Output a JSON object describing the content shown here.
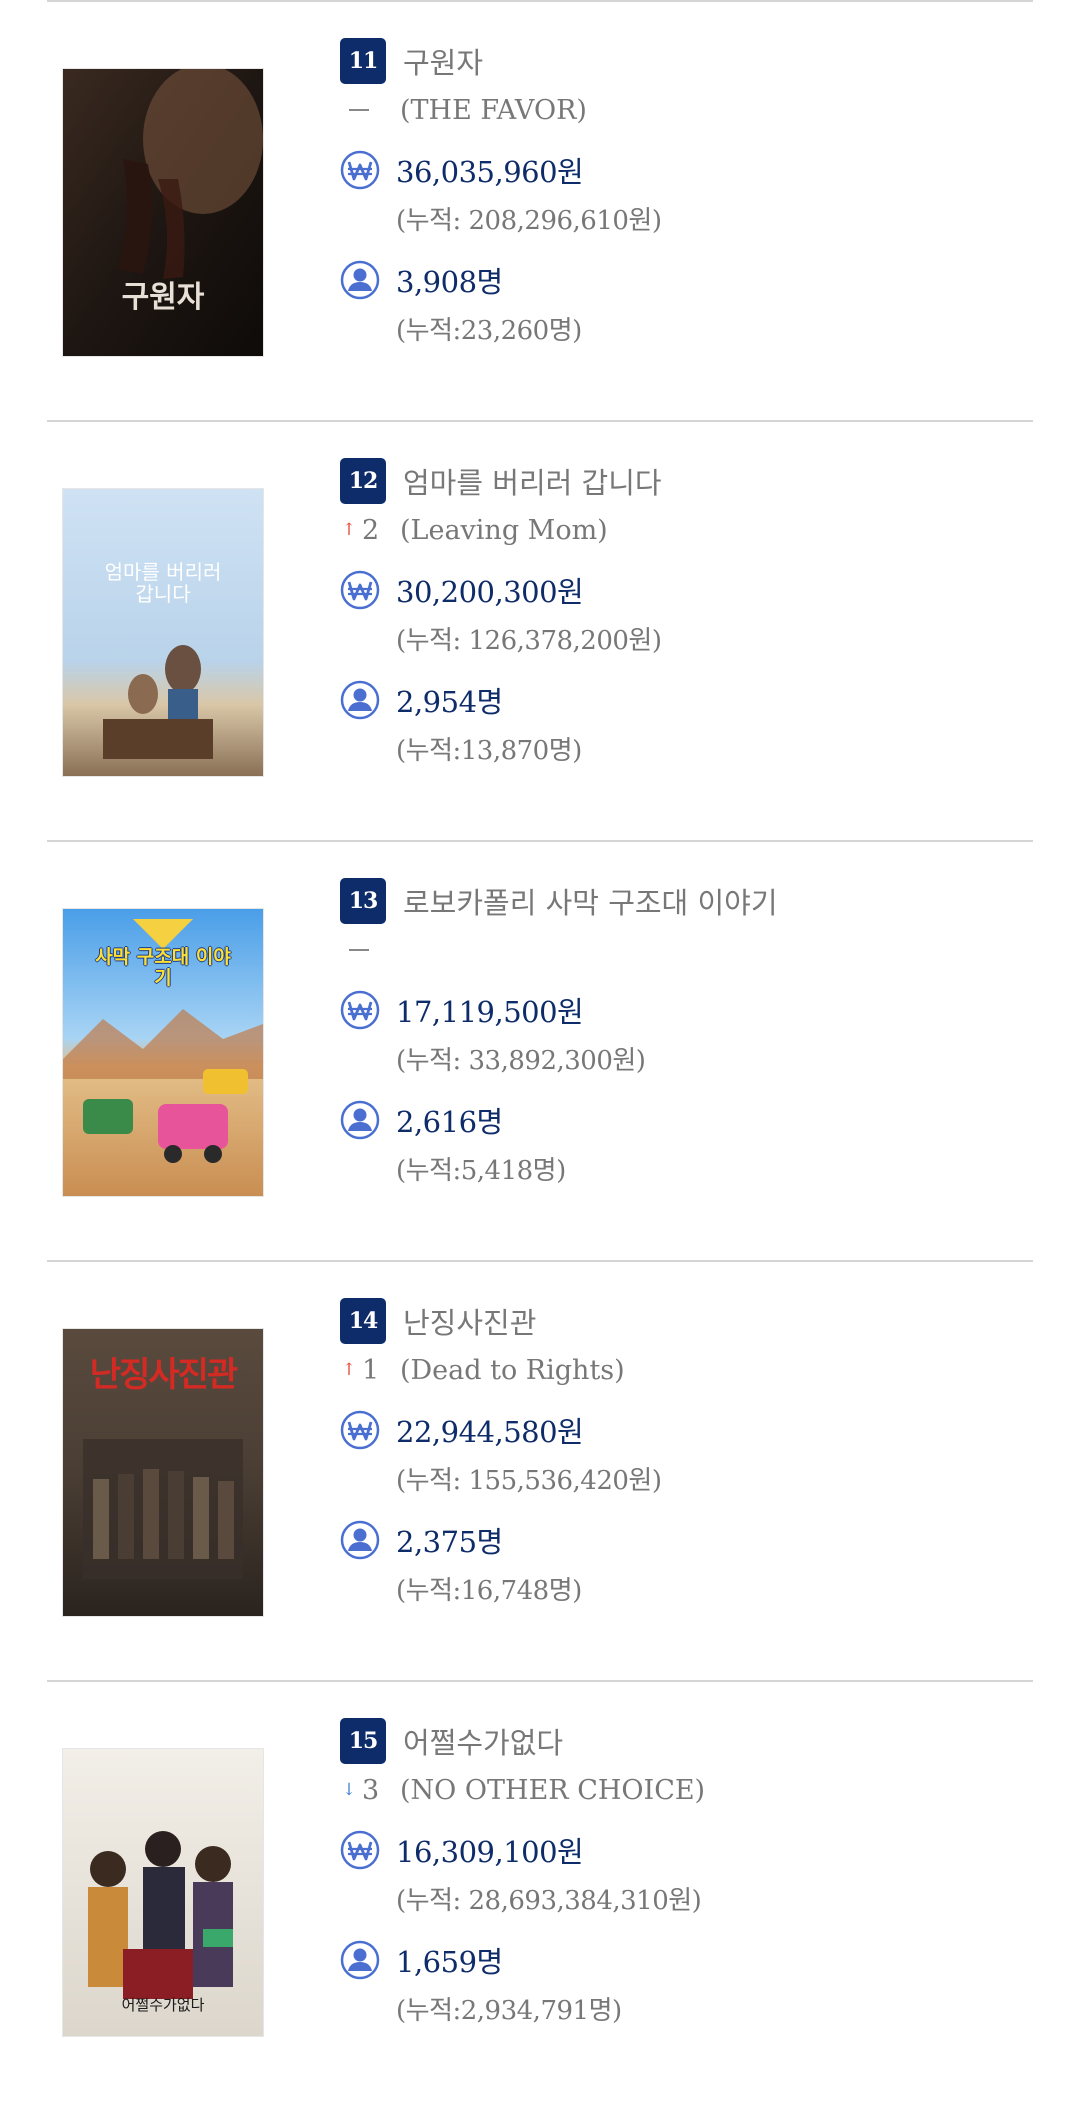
{
  "colors": {
    "badge": "#0f2c6a",
    "value": "#0f2c6a",
    "muted": "#777777",
    "rank_up": "#e84a3b",
    "rank_down": "#4a86d8",
    "icon_blue": "#4a6fd1",
    "divider": "#d5d5d5"
  },
  "entries": [
    {
      "rank": "11",
      "title": "구원자",
      "change_dir": "none",
      "change_text": "",
      "eng_title": "(THE FAVOR)",
      "sales": "36,035,960원",
      "sales_cum": "(누적: 208,296,610원)",
      "audience": "3,908명",
      "audience_cum": "(누적:23,260명)",
      "poster_text": "구원자"
    },
    {
      "rank": "12",
      "title": "엄마를 버리러 갑니다",
      "change_dir": "up",
      "change_text": "2",
      "eng_title": "(Leaving Mom)",
      "sales": "30,200,300원",
      "sales_cum": "(누적: 126,378,200원)",
      "audience": "2,954명",
      "audience_cum": "(누적:13,870명)",
      "poster_text": "엄마를 버리러 갑니다"
    },
    {
      "rank": "13",
      "title": "로보카폴리 사막 구조대 이야기",
      "change_dir": "none",
      "change_text": "",
      "eng_title": "",
      "sales": "17,119,500원",
      "sales_cum": "(누적: 33,892,300원)",
      "audience": "2,616명",
      "audience_cum": "(누적:5,418명)",
      "poster_text": "사막 구조대 이야기"
    },
    {
      "rank": "14",
      "title": "난징사진관",
      "change_dir": "up",
      "change_text": "1",
      "eng_title": "(Dead to Rights)",
      "sales": "22,944,580원",
      "sales_cum": "(누적: 155,536,420원)",
      "audience": "2,375명",
      "audience_cum": "(누적:16,748명)",
      "poster_text": "난징사진관"
    },
    {
      "rank": "15",
      "title": "어쩔수가없다",
      "change_dir": "down",
      "change_text": "3",
      "eng_title": "(NO OTHER CHOICE)",
      "sales": "16,309,100원",
      "sales_cum": "(누적: 28,693,384,310원)",
      "audience": "1,659명",
      "audience_cum": "(누적:2,934,791명)",
      "poster_text": "어쩔수가없다"
    }
  ],
  "icons": {
    "sales": "won-coin-icon",
    "audience": "person-icon",
    "rank_up": "arrow-up-icon",
    "rank_down": "arrow-down-icon"
  }
}
